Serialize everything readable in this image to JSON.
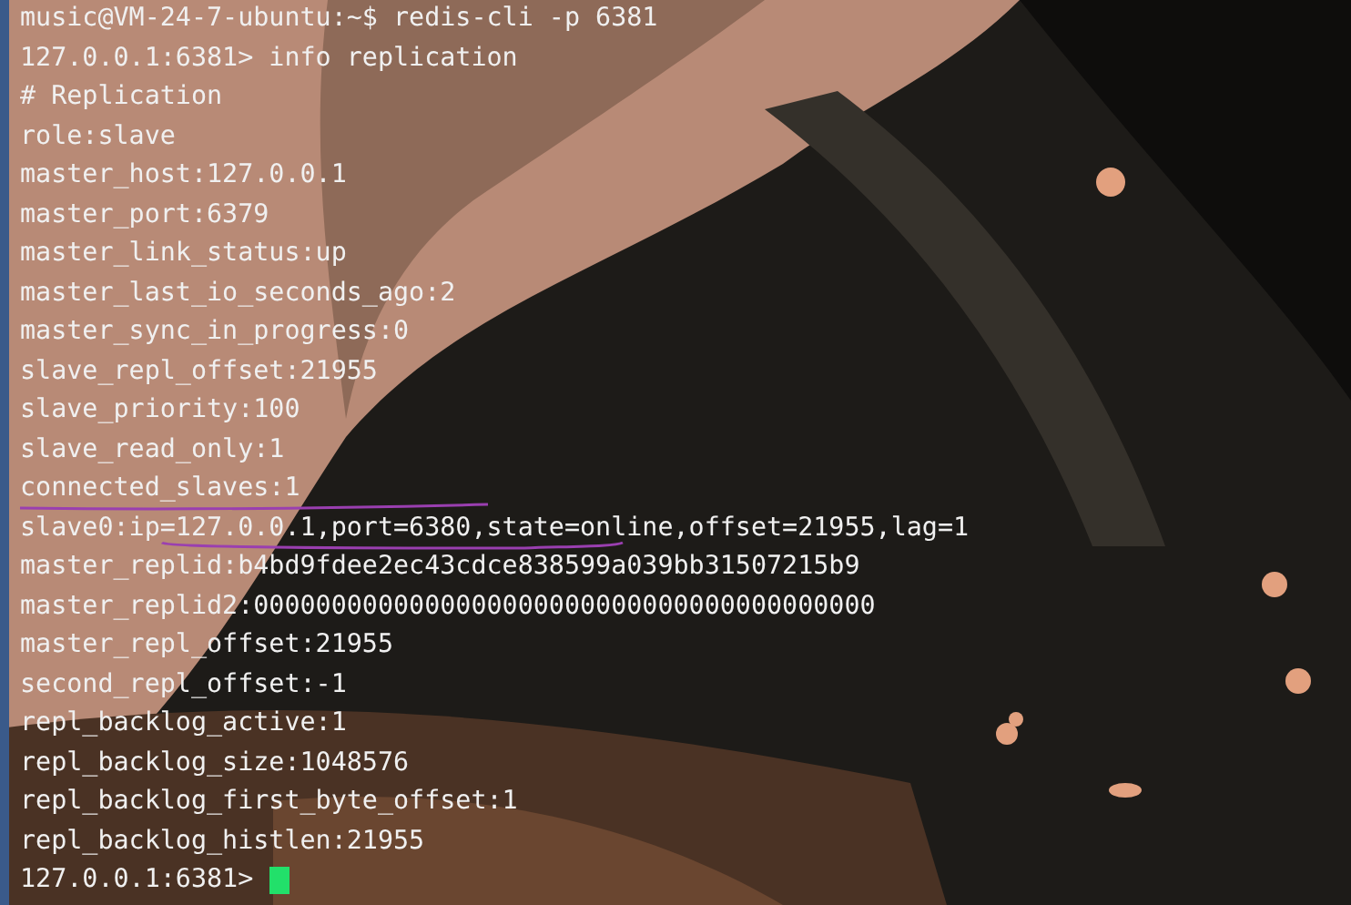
{
  "terminal": {
    "lines": [
      "music@VM-24-7-ubuntu:~$ redis-cli -p 6381",
      "127.0.0.1:6381> info replication",
      "# Replication",
      "role:slave",
      "master_host:127.0.0.1",
      "master_port:6379",
      "master_link_status:up",
      "master_last_io_seconds_ago:2",
      "master_sync_in_progress:0",
      "slave_repl_offset:21955",
      "slave_priority:100",
      "slave_read_only:1",
      "connected_slaves:1",
      "slave0:ip=127.0.0.1,port=6380,state=online,offset=21955,lag=1",
      "master_replid:b4bd9fdee2ec43cdce838599a039bb31507215b9",
      "master_replid2:0000000000000000000000000000000000000000",
      "master_repl_offset:21955",
      "second_repl_offset:-1",
      "repl_backlog_active:1",
      "repl_backlog_size:1048576",
      "repl_backlog_first_byte_offset:1",
      "repl_backlog_histlen:21955"
    ],
    "prompt": "127.0.0.1:6381> "
  }
}
